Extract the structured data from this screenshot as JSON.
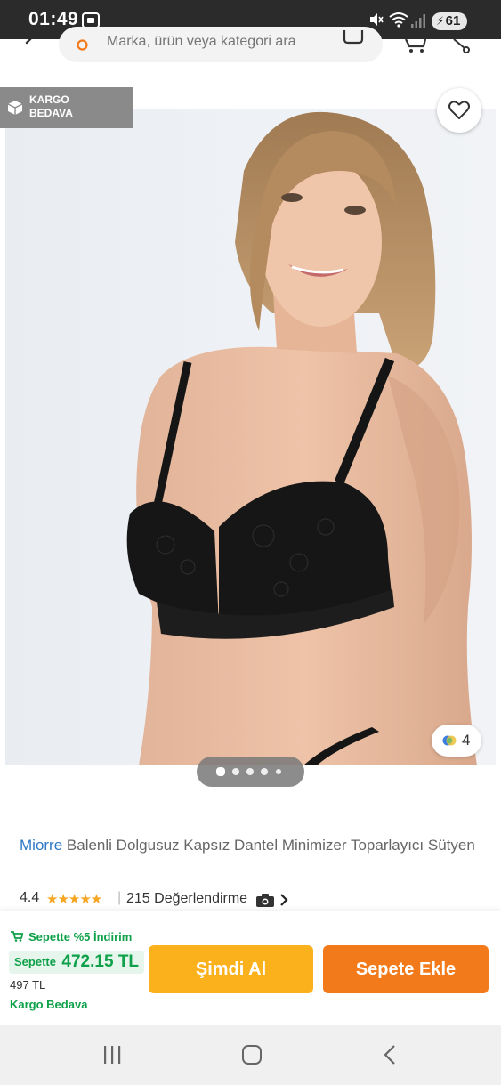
{
  "status_bar": {
    "time": "01:49",
    "battery": "61"
  },
  "header": {
    "search_placeholder": "Marka, ürün veya kategori ara"
  },
  "product": {
    "kargo_badge_line1": "KARGO",
    "kargo_badge_line2": "BEDAVA",
    "color_count": "4",
    "image_count": 5,
    "active_image": 1,
    "brand": "Miorre",
    "name": "Balenli Dolgusuz Kapsız Dantel Minimizer Toparlayıcı Sütyen",
    "rating": "4.4",
    "stars": "★★★★★",
    "review_count": "215 Değerlendirme"
  },
  "bottom_bar": {
    "discount_text": "Sepette %5 İndirim",
    "chip_label": "Sepette",
    "cart_price": "472.15 TL",
    "old_price": "497 TL",
    "free_shipping": "Kargo Bedava",
    "buy_now_label": "Şimdi Al",
    "add_to_cart_label": "Sepete Ekle"
  },
  "colors": {
    "orange": "#f27a1a",
    "yellow": "#fbb11b",
    "green": "#0fa14a",
    "brand_blue": "#2d79c7"
  }
}
